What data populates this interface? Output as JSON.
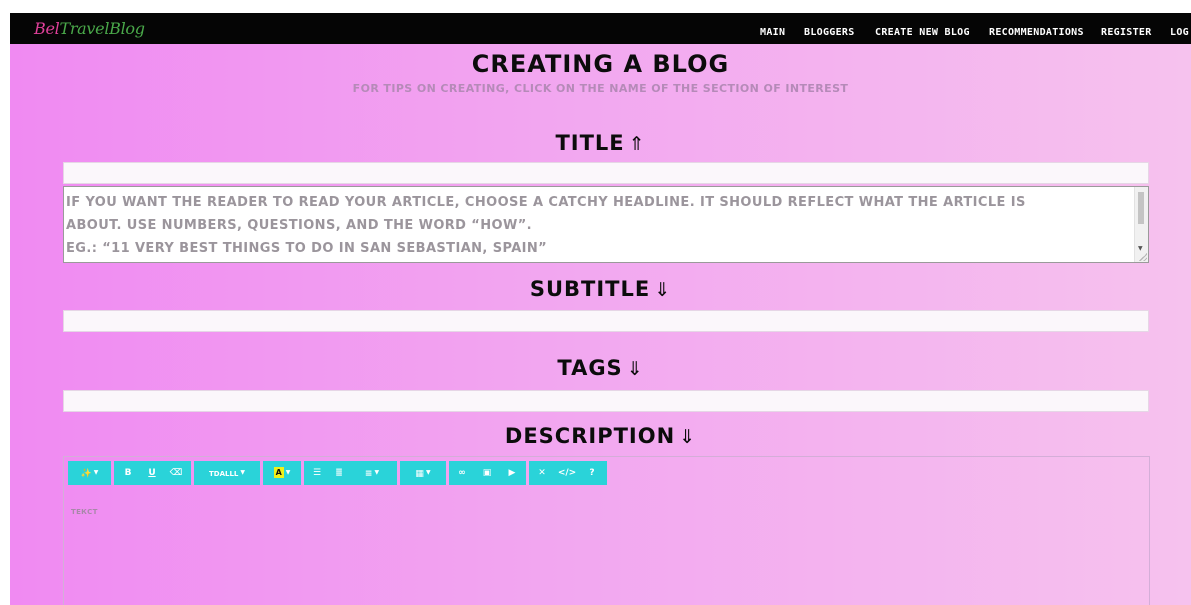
{
  "header": {
    "logo_part1": "Bel",
    "logo_part2": "TravelBlog",
    "nav": [
      "MAIN",
      "BLOGGERS",
      "CREATE NEW BLOG",
      "RECOMMENDATIONS",
      "REGISTER",
      "LOG"
    ]
  },
  "page": {
    "title": "CREATING A BLOG",
    "subtitle": "FOR TIPS ON CREATING, CLICK ON THE NAME OF THE SECTION OF INTEREST"
  },
  "sections": {
    "title": {
      "label": "TITLE",
      "arrow": "⇑",
      "value": ""
    },
    "title_tips": {
      "line1": "IF YOU WANT THE READER TO READ YOUR ARTICLE, CHOOSE A CATCHY HEADLINE. IT SHOULD REFLECT WHAT THE ARTICLE IS",
      "line2": "ABOUT. USE NUMBERS, QUESTIONS, AND THE WORD “HOW”.",
      "line3": "EG.: “11 VERY BEST THINGS TO DO IN SAN SEBASTIAN, SPAIN”"
    },
    "subtitle": {
      "label": "SUBTITLE",
      "arrow": "⇓",
      "value": ""
    },
    "tags": {
      "label": "TAGS",
      "arrow": "⇓",
      "value": ""
    },
    "description": {
      "label": "DESCRIPTION",
      "arrow": "⇓"
    }
  },
  "editor": {
    "toolbar": {
      "magic": "✨",
      "bold": "B",
      "underline": "U",
      "eraser": "⌫",
      "font": "TDALLL",
      "color_swatch": "A",
      "unordered_list": "☰",
      "ordered_list": "≣",
      "align": "≡",
      "table": "▦",
      "link": "∞",
      "image": "▣",
      "video": "▶",
      "fullscreen": "✕",
      "code": "</>",
      "help": "?"
    },
    "placeholder": "ТЕКСТ"
  },
  "colors": {
    "navbar": "#050505",
    "toolbar": "#2ad3d9",
    "gradient_start": "#f08af2",
    "gradient_end": "#f6c2ee"
  }
}
